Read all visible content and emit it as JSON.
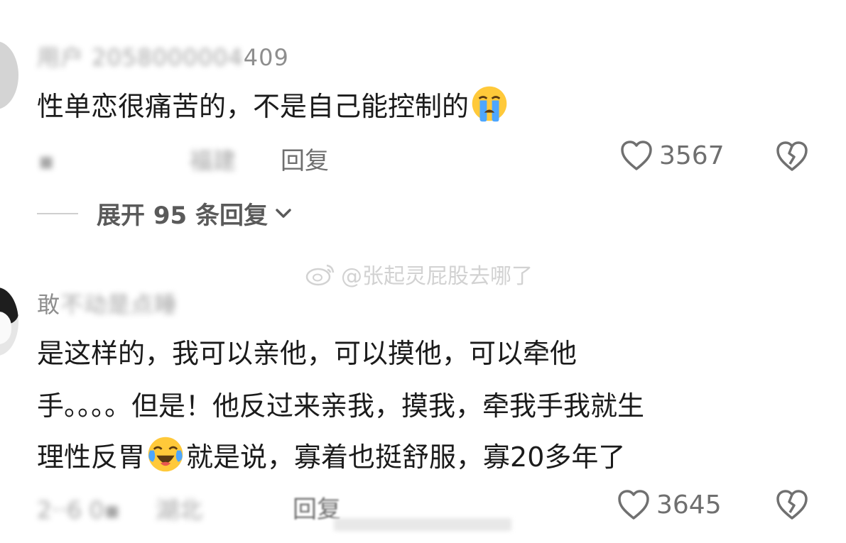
{
  "comments": [
    {
      "username_tail": "409",
      "text": "性单恋很痛苦的，不是自己能控制的",
      "emoji": "loudly-crying-face",
      "reply_label": "回复",
      "likes": "3567",
      "expand_label": "展开 95 条回复"
    },
    {
      "username_head": "敢",
      "text_line1": "是这样的，我可以亲他，可以摸他，可以牵他",
      "text_line2": "手。。。。但是！他反过来亲我，摸我，牵我手我就生",
      "text_line3a": "理性反胃",
      "text_line3b": "就是说，寡着也挺舒服，寡20多年了",
      "emoji": "crying-laughing-face",
      "reply_label": "回复",
      "likes": "3645"
    }
  ],
  "watermark": {
    "text": "@张起灵屁股去哪了"
  },
  "colors": {
    "text": "#1b1b1b",
    "muted": "#8e8e8e",
    "emoji_face": "#ffc93a",
    "emoji_tears": "#4da6ff"
  }
}
